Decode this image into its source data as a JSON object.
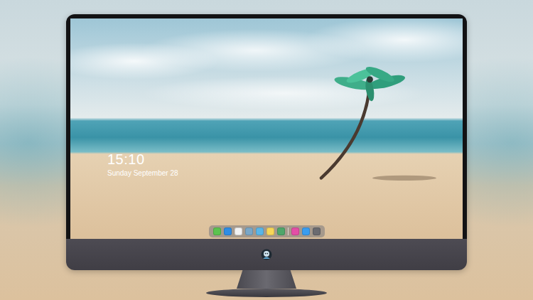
{
  "lock_screen": {
    "time": "15:10",
    "date": "Sunday September 28"
  },
  "dock": {
    "apps": [
      {
        "color": "#5cc34f"
      },
      {
        "color": "#2f8de4"
      },
      {
        "color": "#f2f2f2"
      },
      {
        "color": "#7aa7c7"
      },
      {
        "color": "#5ab6e8"
      },
      {
        "color": "#f7d658"
      },
      {
        "color": "#4fa66a"
      }
    ],
    "others": [
      {
        "color": "#e34fa6"
      },
      {
        "color": "#3a9df0"
      },
      {
        "color": "#6b6b70"
      }
    ]
  }
}
